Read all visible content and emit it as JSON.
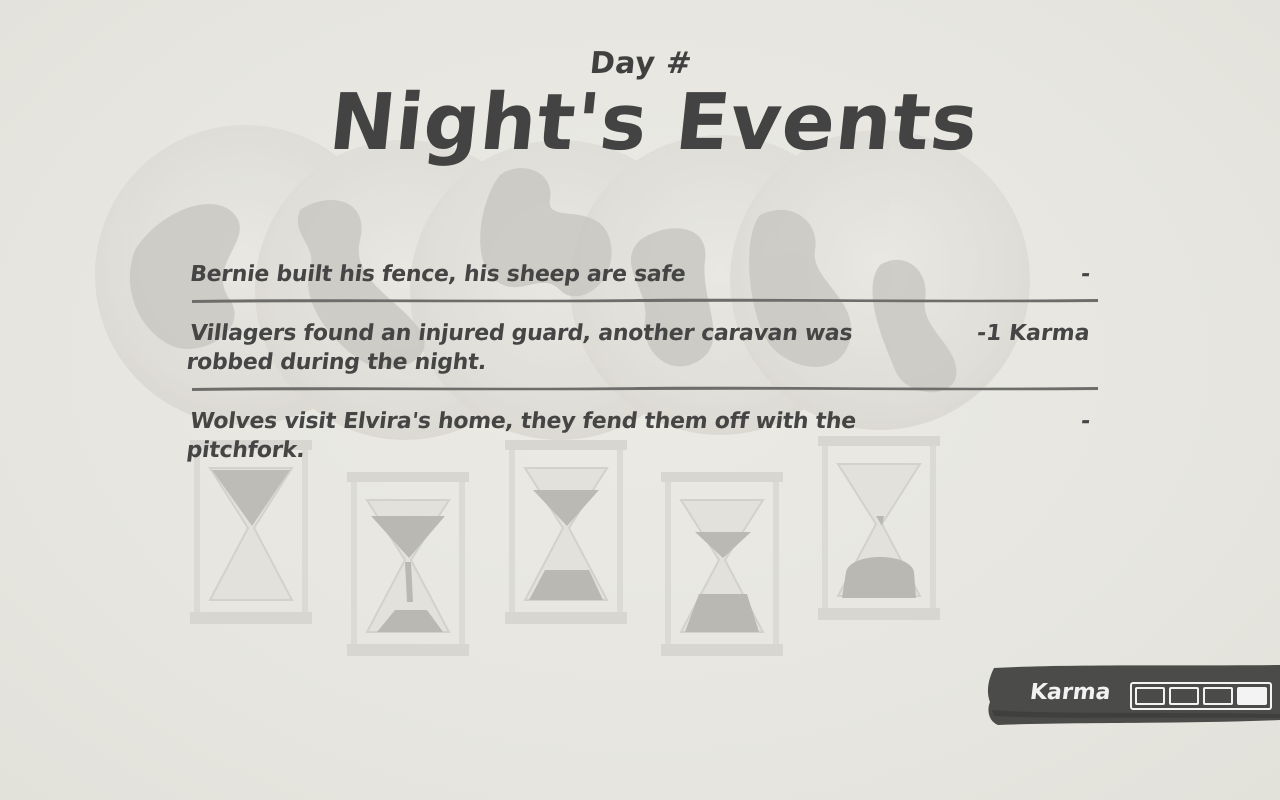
{
  "header": {
    "day_label": "Day #",
    "title": "Night's Events"
  },
  "events": [
    {
      "text": "Bernie built his fence, his sheep are safe",
      "value": "-"
    },
    {
      "text": "Villagers found an injured guard, another caravan was robbed during the night.",
      "value": "-1 Karma"
    },
    {
      "text": "Wolves visit Elvira's home, they fend them off with the pitchfork.",
      "value": "-"
    }
  ],
  "karma": {
    "label": "Karma",
    "total_cells": 4,
    "empty_cells": 3,
    "filled_cells": 1
  },
  "colors": {
    "background": "#e8e7e1",
    "ink": "#434343",
    "panel": "#4a4a4a"
  },
  "icons": {
    "hourglasses": [
      "hourglass-icon",
      "hourglass-icon",
      "hourglass-icon",
      "hourglass-icon",
      "hourglass-icon"
    ]
  }
}
